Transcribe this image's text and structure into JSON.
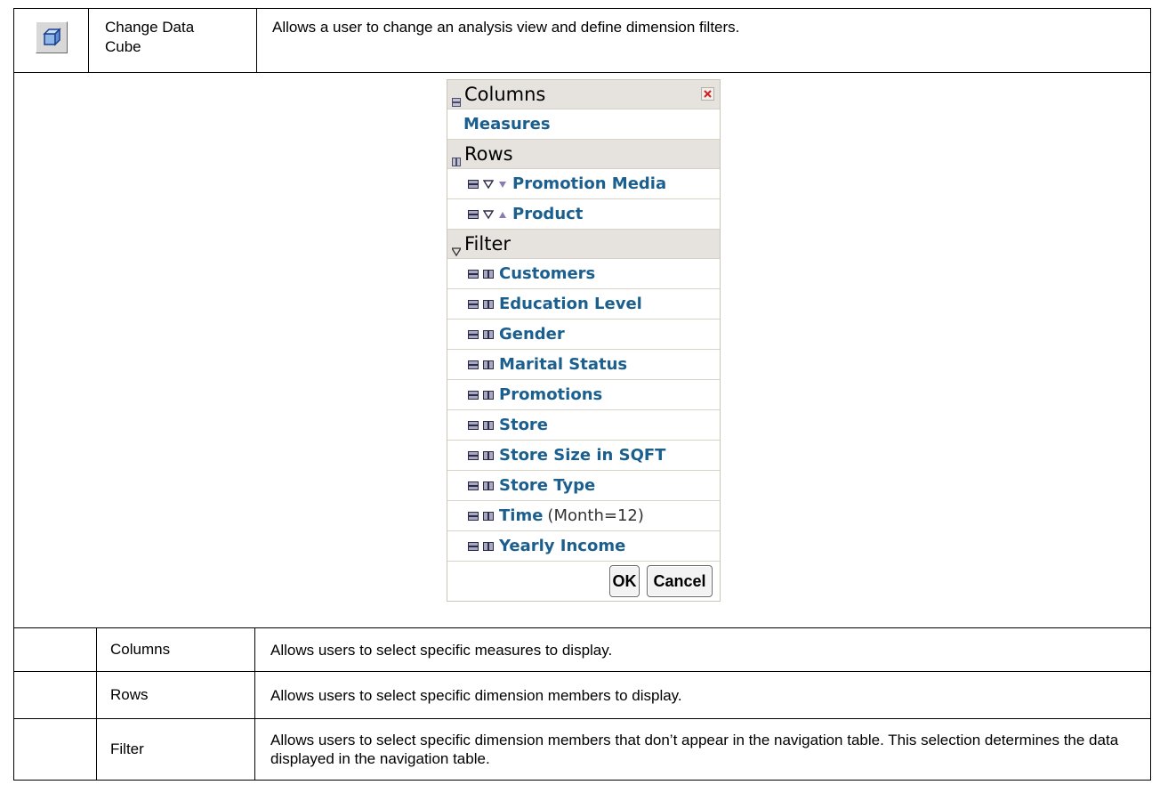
{
  "feature": {
    "icon": "cube-icon",
    "name": "Change Data\nCube",
    "description": "Allows a user to change an analysis view and define dimension filters."
  },
  "cube_panel": {
    "columns_header": "Columns",
    "columns_items": [
      "Measures"
    ],
    "rows_header": "Rows",
    "rows_items": [
      {
        "label": "Promotion Media",
        "sort": "descending"
      },
      {
        "label": "Product",
        "sort": "ascending"
      }
    ],
    "filter_header": "Filter",
    "filter_items": [
      {
        "label": "Customers",
        "extra": ""
      },
      {
        "label": "Education Level",
        "extra": ""
      },
      {
        "label": "Gender",
        "extra": ""
      },
      {
        "label": "Marital Status",
        "extra": ""
      },
      {
        "label": "Promotions",
        "extra": ""
      },
      {
        "label": "Store",
        "extra": ""
      },
      {
        "label": "Store Size in SQFT",
        "extra": ""
      },
      {
        "label": "Store Type",
        "extra": ""
      },
      {
        "label": "Time",
        "extra": "(Month=12)"
      },
      {
        "label": "Yearly Income",
        "extra": ""
      }
    ],
    "ok_label": "OK",
    "cancel_label": "Cancel",
    "colors": {
      "header_bg": "#e6e3df",
      "item_text": "#1b5f8f",
      "close": "#d02020"
    }
  },
  "sub_options": [
    {
      "name": "Columns",
      "description": "Allows users to select specific measures to display."
    },
    {
      "name": "Rows",
      "description": "Allows users to select specific dimension members to display."
    },
    {
      "name": "Filter",
      "description": "Allows users to select specific dimension members that don’t appear in the navigation table. This selection determines the data displayed in the navigation table."
    }
  ]
}
